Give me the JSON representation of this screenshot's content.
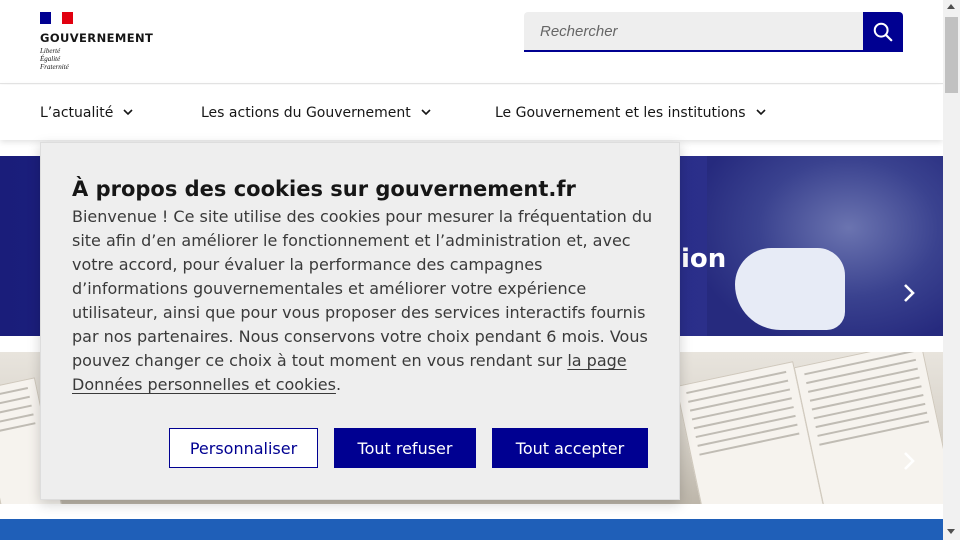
{
  "header": {
    "logo_title": "GOUVERNEMENT",
    "motto": [
      "Liberté",
      "Égalité",
      "Fraternité"
    ],
    "search_placeholder": "Rechercher"
  },
  "nav": {
    "items": [
      {
        "label": "L’actualité"
      },
      {
        "label": "Les actions du Gouvernement"
      },
      {
        "label": "Le Gouvernement et les institutions"
      }
    ]
  },
  "background": {
    "banner1_partial_text": "ion"
  },
  "cookie_modal": {
    "title": "À propos des cookies sur gouvernement.fr",
    "body": "Bienvenue ! Ce site utilise des cookies pour mesurer la fréquentation du site afin d’en améliorer le fonctionnement et l’administration et, avec votre accord, pour évaluer la performance des campagnes d’informations gouvernementales et améliorer votre expérience utilisateur, ainsi que pour vous proposer des services interactifs fournis par nos partenaires. Nous conservons votre choix pendant 6 mois. Vous pouvez changer ce choix à tout moment en vous rendant sur ",
    "link_text": "la page Données personnelles et cookies",
    "body_end": ".",
    "buttons": {
      "customize": "Personnaliser",
      "refuse": "Tout refuser",
      "accept": "Tout accepter"
    }
  },
  "colors": {
    "brand_blue": "#000091",
    "flag_red": "#e1000f"
  }
}
